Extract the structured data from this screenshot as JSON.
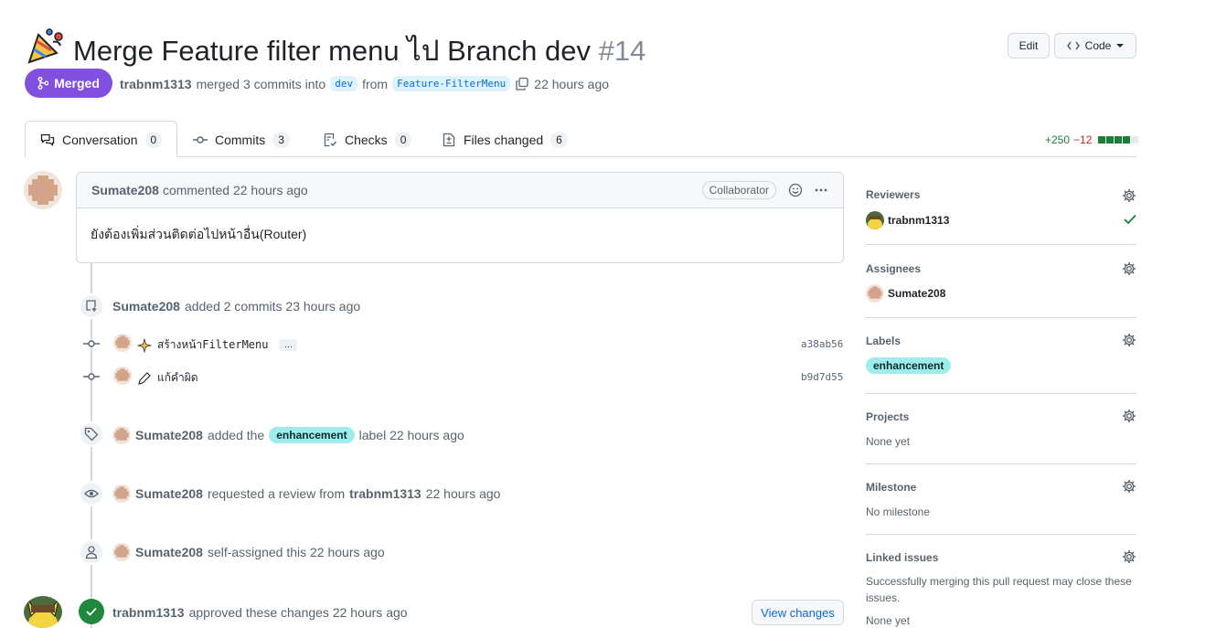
{
  "header": {
    "emoji_icon": "party-popper-icon",
    "title": "Merge Feature filter menu ไป Branch dev",
    "number": "#14",
    "edit_label": "Edit",
    "code_label": "Code",
    "state_label": "Merged",
    "author": "trabnm1313",
    "merged_text": "merged 3 commits into",
    "base_branch": "dev",
    "from_text": "from",
    "head_branch": "Feature-FilterMenu",
    "time": "22 hours ago"
  },
  "tabs": [
    {
      "label": "Conversation",
      "count": "0",
      "icon": "comment-discussion-icon"
    },
    {
      "label": "Commits",
      "count": "3",
      "icon": "git-commit-icon"
    },
    {
      "label": "Checks",
      "count": "0",
      "icon": "checklist-icon"
    },
    {
      "label": "Files changed",
      "count": "6",
      "icon": "file-diff-icon"
    }
  ],
  "diffstat": {
    "additions": "+250",
    "deletions": "−12"
  },
  "comment": {
    "author": "Sumate208",
    "action": "commented 22 hours ago",
    "role": "Collaborator",
    "body": "ยังต้องเพิ่มส่วนติดต่อไปหน้าอื่น(Router)"
  },
  "timeline": {
    "commits_event": {
      "actor": "Sumate208",
      "text": "added 2 commits 23 hours ago"
    },
    "commits": [
      {
        "message": "สร้างหน้าFilterMenu",
        "sha": "a38ab56",
        "has_more": "…"
      },
      {
        "message": "แก้คำผิด",
        "sha": "b9d7d55"
      }
    ],
    "label_event": {
      "actor": "Sumate208",
      "pre": "added the",
      "label": "enhancement",
      "post": "label 22 hours ago"
    },
    "review_event": {
      "actor": "Sumate208",
      "pre": "requested a review from",
      "target": "trabnm1313",
      "post": "22 hours ago"
    },
    "assign_event": {
      "actor": "Sumate208",
      "text": "self-assigned this 22 hours ago"
    },
    "approve_event": {
      "actor": "trabnm1313",
      "text": "approved these changes 22 hours ago",
      "button": "View changes"
    }
  },
  "sidebar": {
    "reviewers": {
      "title": "Reviewers",
      "name": "trabnm1313"
    },
    "assignees": {
      "title": "Assignees",
      "name": "Sumate208"
    },
    "labels": {
      "title": "Labels",
      "label": "enhancement"
    },
    "projects": {
      "title": "Projects",
      "value": "None yet"
    },
    "milestone": {
      "title": "Milestone",
      "value": "No milestone"
    },
    "linked": {
      "title": "Linked issues",
      "desc": "Successfully merging this pull request may close these issues.",
      "value": "None yet"
    }
  },
  "colors": {
    "merged": "#8250df",
    "accent": "#0969da",
    "success": "#1a7f37",
    "label": "#9eedec"
  }
}
